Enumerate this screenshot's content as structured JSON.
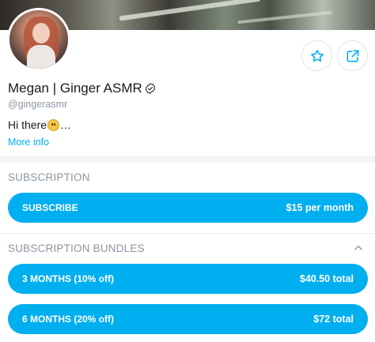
{
  "profile": {
    "name": "Megan | Ginger ASMR",
    "handle": "@gingerasmr",
    "bio_prefix": "Hi there",
    "bio_suffix": "…",
    "more_info": "More info"
  },
  "icons": {
    "favorite": "star-icon",
    "share": "share-icon",
    "verified": "verified-badge-icon",
    "bio_emoji": "smiling-face-emoji",
    "collapse": "chevron-up-icon"
  },
  "subscription": {
    "title": "SUBSCRIPTION",
    "button_label": "SUBSCRIBE",
    "button_price": "$15 per month"
  },
  "bundles": {
    "title": "SUBSCRIPTION BUNDLES",
    "items": [
      {
        "label": "3 MONTHS (10% off)",
        "price": "$40.50 total"
      },
      {
        "label": "6 MONTHS (20% off)",
        "price": "$72 total"
      }
    ]
  },
  "colors": {
    "accent": "#00aff0",
    "muted_text": "#8a96a3"
  }
}
